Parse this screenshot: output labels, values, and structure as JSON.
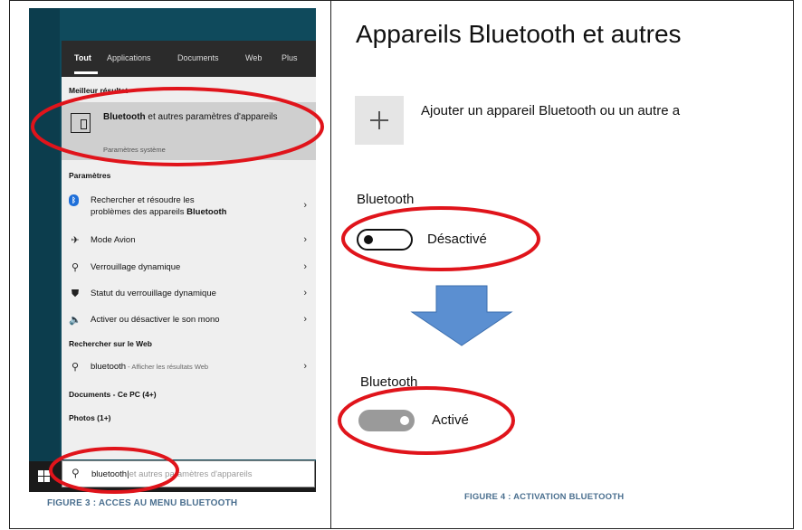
{
  "search_panel": {
    "tabs": [
      "Tout",
      "Applications",
      "Documents",
      "Web",
      "Plus"
    ],
    "best_result_heading": "Meilleur résultat",
    "best_result": {
      "title_bold": "Bluetooth",
      "title_rest": " et autres paramètres d'appareils",
      "subtitle": "Paramètres système",
      "icon": "device-settings-icon"
    },
    "settings_heading": "Paramètres",
    "settings_items": [
      {
        "label_line1": "Rechercher et résoudre les",
        "label_line2_prefix": "problèmes des appareils ",
        "label_line2_bold": "Bluetooth",
        "icon": "bluetooth-icon"
      },
      {
        "label": "Mode Avion",
        "icon": "airplane-icon"
      },
      {
        "label": "Verrouillage dynamique",
        "icon": "key-icon"
      },
      {
        "label": "Statut du verrouillage dynamique",
        "icon": "shield-icon"
      },
      {
        "label": "Activer ou désactiver le son mono",
        "icon": "speaker-icon"
      }
    ],
    "web_heading": "Rechercher sur le Web",
    "web_item": {
      "query": "bluetooth",
      "hint": " - Afficher les résultats Web",
      "icon": "search-icon"
    },
    "documents_heading": "Documents - Ce PC (4+)",
    "photos_heading": "Photos (1+)",
    "search_box": {
      "typed": "bluetooth",
      "ghost": "et autres paramètres d'appareils",
      "icon": "search-icon"
    }
  },
  "settings_panel": {
    "title": "Appareils Bluetooth et autres",
    "add_device_label": "Ajouter un appareil Bluetooth ou un autre a",
    "before": {
      "label": "Bluetooth",
      "state": "Désactivé",
      "toggle_on": false
    },
    "after": {
      "label": "Bluetooth",
      "state": "Activé",
      "toggle_on": true
    }
  },
  "captions": {
    "figure3": "FIGURE 3 : ACCES AU MENU BLUETOOTH",
    "figure4": "FIGURE 4 : ACTIVATION BLUETOOTH"
  },
  "colors": {
    "annotation_red": "#e0141b",
    "arrow_blue": "#5b8fd1",
    "caption_blue": "#4a6f8f"
  }
}
